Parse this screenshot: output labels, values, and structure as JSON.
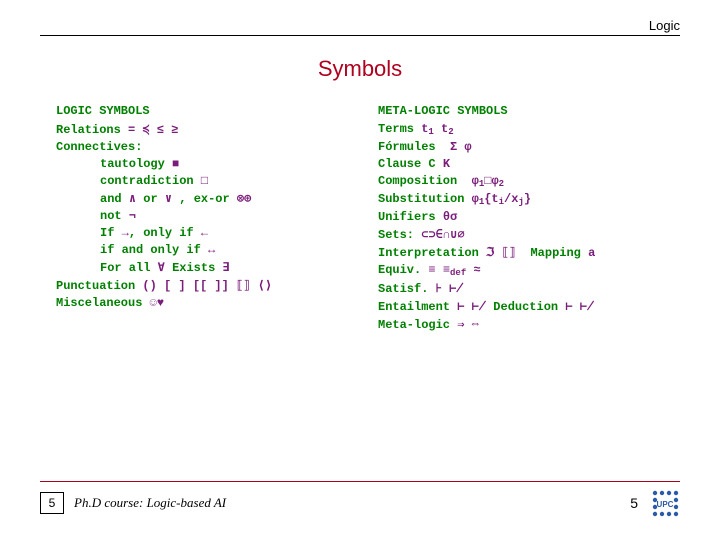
{
  "header": {
    "topic": "Logic"
  },
  "title": "Symbols",
  "left": {
    "heading": "LOGIC SYMBOLS",
    "relations": {
      "label": "Relations",
      "sym": "= ≼ ≤ ≥"
    },
    "connectives": {
      "label": "Connectives:"
    },
    "tautology": {
      "label": "tautology",
      "sym": "■"
    },
    "contradiction": {
      "label": "contradiction",
      "sym": "□"
    },
    "andor": {
      "label_and": "and",
      "sym_and": "∧",
      "label_or": "or",
      "sym_or": "∨",
      "label_ex": ", ex-or",
      "sym_ex": "⊗⊕"
    },
    "not": {
      "label": "not",
      "sym": "¬"
    },
    "if": {
      "label_if": "If",
      "sym_if": "→",
      "label_only": ", only if",
      "sym_only": "←"
    },
    "iff": {
      "label": "if and only if",
      "sym": "↔"
    },
    "quant": {
      "label_all": "For all",
      "sym_all": "∀",
      "label_ex": "Exists",
      "sym_ex": "∃"
    },
    "punct": {
      "label": "Punctuation",
      "sym": "() [ ] [[ ]] ⟦⟧ ⟨⟩"
    },
    "misc": {
      "label": "Miscelaneous",
      "sym": "☺♥"
    }
  },
  "right": {
    "heading": "META-LOGIC SYMBOLS",
    "terms": {
      "label": "Terms",
      "s1": "t",
      "i1": "1",
      "s2": "t",
      "i2": "2"
    },
    "formules": {
      "label": "Fórmules",
      "sym": "Σ φ"
    },
    "clause": {
      "label": "Clause C",
      "sym": "K"
    },
    "comp": {
      "label": "Composition",
      "s1": "φ",
      "i1": "1",
      "mid": "□",
      "s2": "φ",
      "i2": "2"
    },
    "subst": {
      "label": "Substitution",
      "s": "φ",
      "i": "1",
      "tail": "{t",
      "ti": "i",
      "mid": "/x",
      "xj": "j",
      "end": "}"
    },
    "unif": {
      "label": "Unifiers",
      "sym": "θσ"
    },
    "sets": {
      "label": "Sets:",
      "sym": "⊂⊃∈∩∪∅"
    },
    "interp": {
      "label": "Interpretation",
      "sym": "ℑ ⟦⟧",
      "map_label": "Mapping",
      "map_sym": "a"
    },
    "equiv": {
      "label": "Equiv.",
      "sym": "≡ ≡",
      "def": "def",
      "tail": "≈"
    },
    "satisf": {
      "label": "Satisf.",
      "sym": "⊦ ⊬"
    },
    "entail": {
      "label": "Entailment",
      "sym": "⊢ ⊬",
      "ded_label": "Deduction",
      "ded_sym": "⊢ ⊬"
    },
    "meta": {
      "label": "Meta-logic",
      "sym": "⇒ ⇔"
    }
  },
  "footer": {
    "page_left": "5",
    "course": "Ph.D course: Logic-based AI",
    "page_right": "5"
  }
}
